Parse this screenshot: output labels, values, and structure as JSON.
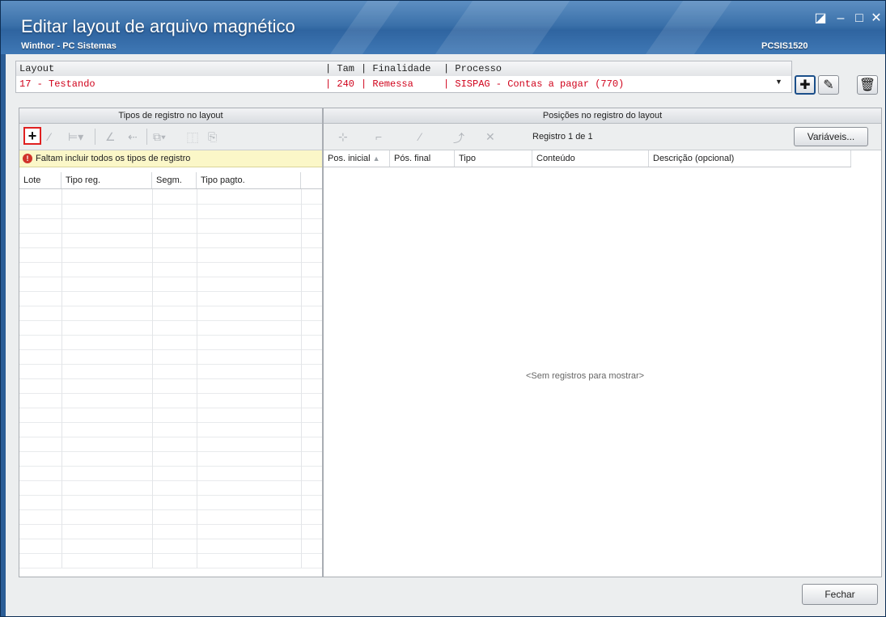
{
  "window": {
    "title": "Editar layout de arquivo magnético",
    "subtitle": "Winthor - PC Sistemas",
    "code": "PCSIS1520",
    "controls": [
      "resize-icon",
      "minimize-icon",
      "maximize-icon",
      "close-icon"
    ]
  },
  "layout_combo": {
    "headers": {
      "layout": "Layout",
      "tam": "| Tam",
      "finalidade": "| Finalidade",
      "processo": "| Processo"
    },
    "row": {
      "layout": "17 - Testando",
      "tam": "| 240",
      "finalidade": "| Remessa",
      "processo": "| SISPAG - Contas a pagar (770)"
    },
    "selected_color": "#d0021b"
  },
  "layout_actions": [
    "add-icon",
    "edit-icon",
    "trash-icon"
  ],
  "left_panel": {
    "title": "Tipos de registro no layout",
    "warning": "Faltam incluir todos os tipos de registro",
    "columns": [
      "Lote",
      "Tipo reg.",
      "Segm.",
      "Tipo pagto."
    ],
    "rows": []
  },
  "right_panel": {
    "title": "Posições no registro do layout",
    "record_counter": "Registro 1 de 1",
    "variables_button": "Variáveis...",
    "columns": [
      "Pos. inicial",
      "Pós. final",
      "Tipo",
      "Conteúdo",
      "Descrição (opcional)"
    ],
    "empty_message": "<Sem registros para mostrar>",
    "rows": []
  },
  "footer": {
    "close_button": "Fechar"
  }
}
